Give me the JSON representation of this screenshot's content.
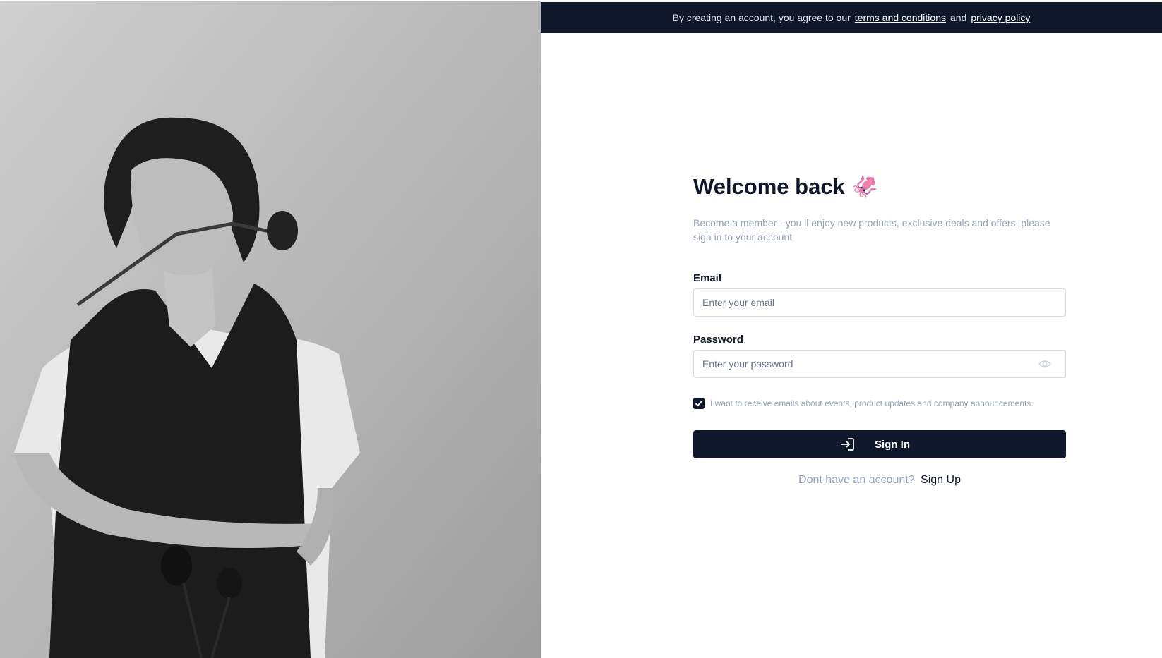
{
  "hero": {
    "image_description": "",
    "tone": "monochrome"
  },
  "banner": {
    "prefix": "By creating an account, you agree to our",
    "terms_link": "terms and conditions",
    "conjunction": "and",
    "privacy_link": "privacy policy",
    "background": "#0f172a"
  },
  "form": {
    "title": "Welcome back",
    "title_emoji": "🦑",
    "subtitle": "Become a member - you ll enjoy new products, exclusive deals and offers. please sign in to your account",
    "email": {
      "label": "Email",
      "value": "",
      "placeholder": "Enter your email"
    },
    "password": {
      "label": "Password",
      "value": "",
      "placeholder": "Enter your password",
      "icon": "eye-icon"
    },
    "marketing_opt_in": {
      "checked": true,
      "label": "I want to receive emails about events, product updates and company announcements."
    },
    "submit": {
      "label": "Sign In",
      "icon": "sign-in-icon"
    },
    "signup_prompt": {
      "question": "Dont have an account?",
      "link": "Sign Up"
    }
  },
  "colors": {
    "primary": "#0f172a",
    "muted_text": "#94a3b8",
    "input_border": "#d7dde5"
  }
}
